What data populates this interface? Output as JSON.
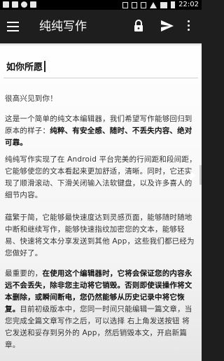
{
  "status_bar": {
    "time": "22:02",
    "left_icons": [
      "image-notif-icon",
      "image-notif-icon",
      "android-icon",
      "calendar-icon"
    ],
    "right_icons": [
      "bluetooth-icon",
      "vibrate-icon",
      "alarm-icon",
      "wifi-icon",
      "signal-icon",
      "battery-icon"
    ]
  },
  "app_bar": {
    "title": "纯纯写作",
    "icons": [
      "menu-icon",
      "lock-icon",
      "send-icon",
      "more-icon"
    ]
  },
  "document": {
    "title": "如你所愿",
    "paragraphs": [
      [
        {
          "t": "很高兴见到你！",
          "b": false
        }
      ],
      [
        {
          "t": "这是一个简单的纯文本编辑器，我们希望写作能够回归到原本的样子：",
          "b": false
        },
        {
          "t": "纯粹、有安全感、随时、不丢失内容、绝对可靠。",
          "b": true
        }
      ],
      [
        {
          "t": "纯纯写作实现了在 Android 平台完美的行间距和段间距，它能够使您的文本看起来更加舒适，清晰。同时，它还实现了顺滑滚动、下滑关闭输入法软键盘，以及许多喜人的细节内容。",
          "b": false
        }
      ],
      [
        {
          "t": "蕴繁于简，它能够最快速度达到灵感页面，能够随时随地中断和继续写作，能够快速指纹加密您的文本，能够轻易、快速将文本分享发送到其他 App，这些我们都已经为您做好了。",
          "b": false
        }
      ],
      [
        {
          "t": "最重要的，",
          "b": false
        },
        {
          "t": "在使用这个编辑器时，它将会保证您的内容永远不会丢失，除非您主动将它销毁。否则即使误操作将文本删除，或瞬间断电，您仍然能够从历史记录中将它恢复。",
          "b": true
        },
        {
          "t": "目前初级版本中，您同一时间只能编辑一篇文章，当您完成全篇文章写作之后，可以选择 右上角发送按钮 将它发送和妥存到另外的 App，然后销毁本文，开启新篇章。",
          "b": false
        }
      ]
    ]
  }
}
